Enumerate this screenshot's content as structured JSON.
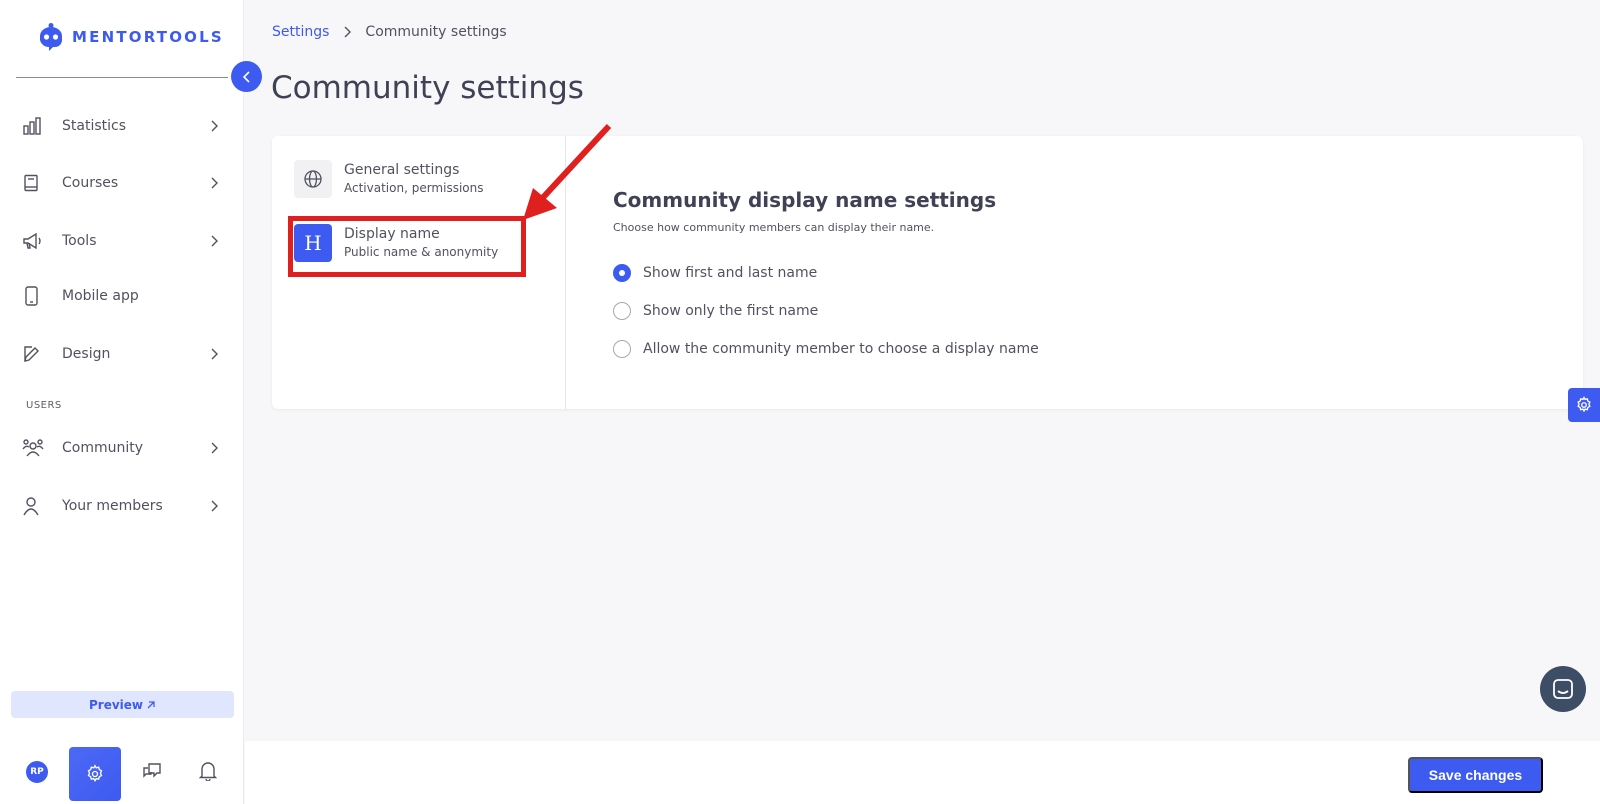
{
  "brand": {
    "name": "MENTORTOOLS",
    "color": "#3d5af1"
  },
  "sidebar": {
    "items": [
      {
        "label": "Statistics",
        "icon": "bar-chart-icon",
        "has_chevron": true
      },
      {
        "label": "Courses",
        "icon": "book-icon",
        "has_chevron": true
      },
      {
        "label": "Tools",
        "icon": "megaphone-icon",
        "has_chevron": true
      },
      {
        "label": "Mobile app",
        "icon": "phone-icon",
        "has_chevron": false
      },
      {
        "label": "Design",
        "icon": "pencil-icon",
        "has_chevron": true
      }
    ],
    "section_users": "USERS",
    "user_items": [
      {
        "label": "Community",
        "icon": "people-icon",
        "has_chevron": true
      },
      {
        "label": "Your members",
        "icon": "user-icon",
        "has_chevron": true
      }
    ],
    "preview_label": "Preview",
    "avatar_initials": "RP"
  },
  "breadcrumb": {
    "parent": "Settings",
    "current": "Community settings"
  },
  "page_title": "Community settings",
  "settings_menu": [
    {
      "title": "General settings",
      "subtitle": "Activation, permissions",
      "icon": "globe-icon"
    },
    {
      "title": "Display name",
      "subtitle": "Public name & anonymity",
      "icon": "heading-icon",
      "icon_letter": "H"
    }
  ],
  "content": {
    "title": "Community display name settings",
    "subtitle": "Choose how community members can display their name.",
    "options": [
      {
        "label": "Show first and last name",
        "checked": true
      },
      {
        "label": "Show only the first name",
        "checked": false
      },
      {
        "label": "Allow the community member to choose a display name",
        "checked": false
      }
    ]
  },
  "footer": {
    "save_label": "Save changes"
  },
  "colors": {
    "accent": "#3d5af1",
    "annotation": "#e0201f",
    "chat": "#3d4d66"
  }
}
